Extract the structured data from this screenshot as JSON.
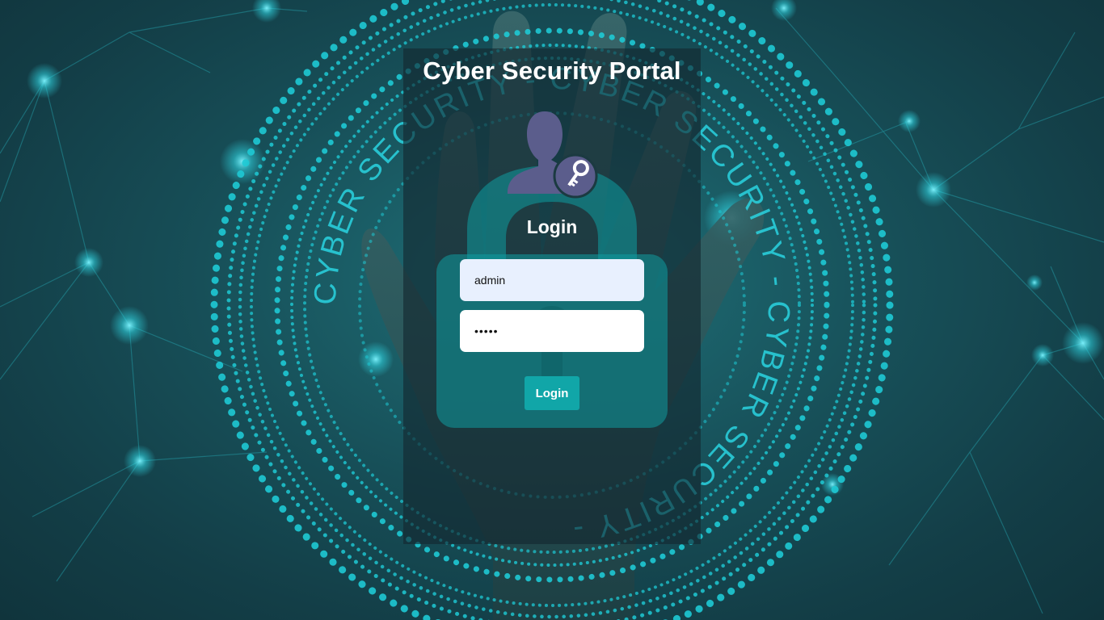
{
  "page": {
    "title": "Cyber Security Portal",
    "background_text": "CYBER SECURITY - CYBER SECURITY - CYBER SECURITY - "
  },
  "login_form": {
    "heading": "Login",
    "username_value": "admin",
    "password_value": "•••••",
    "submit_label": "Login"
  },
  "icons": {
    "avatar": "user-key-icon",
    "lock": "padlock-icon"
  },
  "colors": {
    "accent": "#11a6a8",
    "ring": "#1ec9d4",
    "avatar": "#5b5d8c",
    "input_autofill": "#e8f0fe"
  }
}
